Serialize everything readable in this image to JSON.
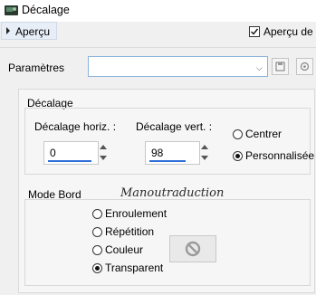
{
  "window": {
    "title": "Décalage"
  },
  "toolbar": {
    "preview_label": "Aperçu",
    "live_preview_label": "Aperçu de l",
    "live_preview_checked": true
  },
  "params": {
    "label": "Paramètres",
    "preset_value": ""
  },
  "offset": {
    "group_title": "Décalage",
    "horiz_label": "Décalage horiz. :",
    "horiz_value": "0",
    "vert_label": "Décalage vert. :",
    "vert_value": "98",
    "options": [
      {
        "label": "Centrer",
        "selected": false
      },
      {
        "label": "Personnalisée",
        "selected": true
      }
    ]
  },
  "edge": {
    "group_title": "Mode Bord",
    "options": [
      {
        "label": "Enroulement",
        "selected": false
      },
      {
        "label": "Répétition",
        "selected": false
      },
      {
        "label": "Couleur",
        "selected": false
      },
      {
        "label": "Transparent",
        "selected": true
      }
    ]
  },
  "watermark": "Manoutraduction",
  "icons": {
    "app": "app-icon",
    "save": "save-icon",
    "reset": "reset-icon",
    "no_color": "no-color-icon"
  },
  "colors": {
    "accent": "#2e6fd9",
    "field_border_focus": "#8bb2dd"
  }
}
